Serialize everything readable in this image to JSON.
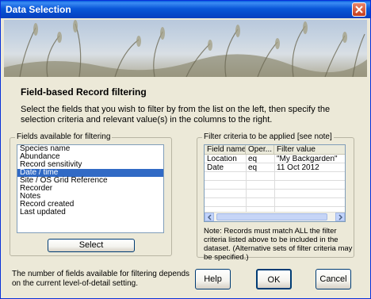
{
  "window": {
    "title": "Data Selection"
  },
  "heading": "Field-based Record filtering",
  "instructions": "Select the fields that you wish to filter by from the list on the left, then specify the selection criteria and relevant value(s) in the columns to the right.",
  "fields_group": {
    "legend": "Fields available for filtering",
    "items": [
      "Species name",
      "Abundance",
      "Record sensitivity",
      "Date / time",
      "Site / OS Grid Reference",
      "Recorder",
      "Notes",
      "Record created",
      "Last updated"
    ],
    "selected_index": 3,
    "select_button": "Select"
  },
  "criteria_group": {
    "legend": "Filter criteria to be applied [see note]",
    "columns": [
      "Field name",
      "Oper...",
      "Filter value"
    ],
    "rows": [
      [
        "Location",
        "eq",
        "\"My Backgarden\""
      ],
      [
        "Date",
        "eq",
        "11 Oct 2012"
      ]
    ],
    "note": "Note: Records must match ALL the filter criteria listed above to be included in the dataset. (Alternative sets of filter criteria may be specified.)"
  },
  "footer_text": "The number of fields available for filtering depends on the current level-of-detail setting.",
  "buttons": {
    "help": "Help",
    "ok": "OK",
    "cancel": "Cancel"
  },
  "colors": {
    "title_bar": "#0a57d8",
    "selection": "#316ac5",
    "window_bg": "#ece9d8"
  },
  "icons": {
    "close": "close-icon",
    "scroll_left": "chevron-left-icon",
    "scroll_right": "chevron-right-icon"
  }
}
